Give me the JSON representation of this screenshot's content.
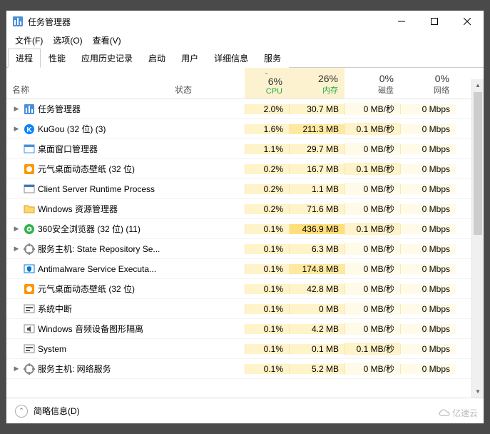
{
  "window": {
    "title": "任务管理器"
  },
  "menu": {
    "file": "文件(F)",
    "options": "选项(O)",
    "view": "查看(V)"
  },
  "tabs": [
    {
      "label": "进程",
      "active": true
    },
    {
      "label": "性能"
    },
    {
      "label": "应用历史记录"
    },
    {
      "label": "启动"
    },
    {
      "label": "用户"
    },
    {
      "label": "详细信息"
    },
    {
      "label": "服务"
    }
  ],
  "headers": {
    "name": "名称",
    "status": "状态",
    "cpu": {
      "pct": "6%",
      "label": "CPU"
    },
    "mem": {
      "pct": "26%",
      "label": "内存"
    },
    "disk": {
      "pct": "0%",
      "label": "磁盘"
    },
    "net": {
      "pct": "0%",
      "label": "网络"
    }
  },
  "processes": [
    {
      "expandable": true,
      "icon": "taskmgr",
      "name": "任务管理器",
      "cpu": "2.0%",
      "mem": "30.7 MB",
      "mem_heat": 1,
      "disk": "0 MB/秒",
      "net": "0 Mbps"
    },
    {
      "expandable": true,
      "icon": "kugou",
      "name": "KuGou (32 位) (3)",
      "cpu": "1.6%",
      "mem": "211.3 MB",
      "mem_heat": 2,
      "disk": "0.1 MB/秒",
      "disk_heat": 1,
      "net": "0 Mbps"
    },
    {
      "expandable": false,
      "icon": "dwm",
      "name": "桌面窗口管理器",
      "cpu": "1.1%",
      "mem": "29.7 MB",
      "mem_heat": 1,
      "disk": "0 MB/秒",
      "net": "0 Mbps"
    },
    {
      "expandable": false,
      "icon": "yuanqi",
      "name": "元气桌面动态壁纸 (32 位)",
      "cpu": "0.2%",
      "mem": "16.7 MB",
      "mem_heat": 1,
      "disk": "0.1 MB/秒",
      "disk_heat": 1,
      "net": "0 Mbps"
    },
    {
      "expandable": false,
      "icon": "csr",
      "name": "Client Server Runtime Process",
      "cpu": "0.2%",
      "mem": "1.1 MB",
      "mem_heat": 1,
      "disk": "0 MB/秒",
      "net": "0 Mbps"
    },
    {
      "expandable": false,
      "icon": "explorer",
      "name": "Windows 资源管理器",
      "cpu": "0.2%",
      "mem": "71.6 MB",
      "mem_heat": 1,
      "disk": "0 MB/秒",
      "net": "0 Mbps"
    },
    {
      "expandable": true,
      "icon": "360",
      "name": "360安全浏览器 (32 位) (11)",
      "cpu": "0.1%",
      "mem": "436.9 MB",
      "mem_heat": 3,
      "disk": "0.1 MB/秒",
      "disk_heat": 1,
      "net": "0 Mbps"
    },
    {
      "expandable": true,
      "icon": "svchost",
      "name": "服务主机: State Repository Se...",
      "cpu": "0.1%",
      "mem": "6.3 MB",
      "mem_heat": 1,
      "disk": "0 MB/秒",
      "net": "0 Mbps"
    },
    {
      "expandable": false,
      "icon": "defender",
      "name": "Antimalware Service Executa...",
      "cpu": "0.1%",
      "mem": "174.8 MB",
      "mem_heat": 2,
      "disk": "0 MB/秒",
      "net": "0 Mbps"
    },
    {
      "expandable": false,
      "icon": "yuanqi",
      "name": "元气桌面动态壁纸 (32 位)",
      "cpu": "0.1%",
      "mem": "42.8 MB",
      "mem_heat": 1,
      "disk": "0 MB/秒",
      "net": "0 Mbps"
    },
    {
      "expandable": false,
      "icon": "sys",
      "name": "系统中断",
      "cpu": "0.1%",
      "mem": "0 MB",
      "mem_heat": 1,
      "disk": "0 MB/秒",
      "net": "0 Mbps"
    },
    {
      "expandable": false,
      "icon": "audio",
      "name": "Windows 音频设备图形隔离",
      "cpu": "0.1%",
      "mem": "4.2 MB",
      "mem_heat": 1,
      "disk": "0 MB/秒",
      "net": "0 Mbps"
    },
    {
      "expandable": false,
      "icon": "sys",
      "name": "System",
      "cpu": "0.1%",
      "mem": "0.1 MB",
      "mem_heat": 1,
      "disk": "0.1 MB/秒",
      "disk_heat": 1,
      "net": "0 Mbps"
    },
    {
      "expandable": true,
      "icon": "svchost",
      "name": "服务主机: 网络服务",
      "cpu": "0.1%",
      "mem": "5.2 MB",
      "mem_heat": 1,
      "disk": "0 MB/秒",
      "net": "0 Mbps"
    }
  ],
  "footer": {
    "text": "简略信息(D)"
  },
  "watermark": "亿速云"
}
